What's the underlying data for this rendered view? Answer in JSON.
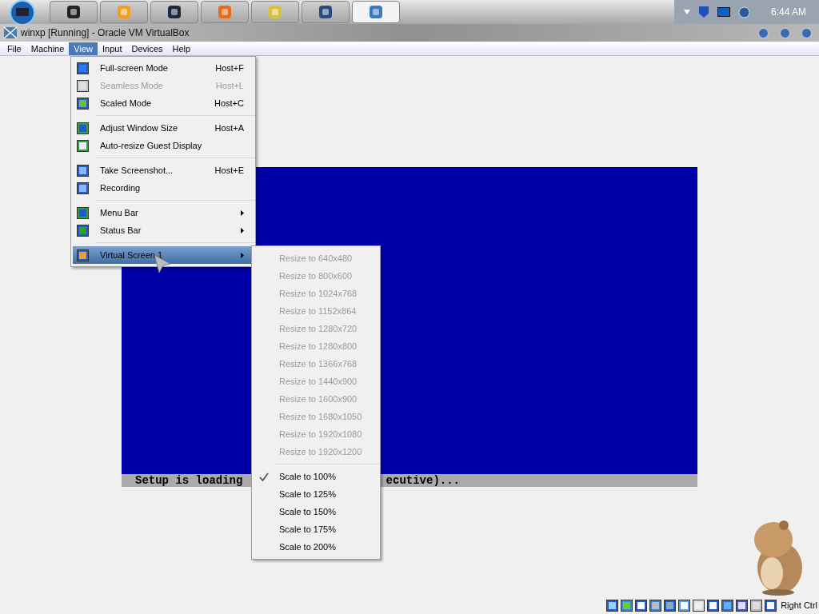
{
  "taskbar": {
    "apps": [
      {
        "selected": false
      },
      {
        "selected": false
      },
      {
        "selected": false
      },
      {
        "selected": false
      },
      {
        "selected": false
      },
      {
        "selected": false
      },
      {
        "selected": true
      }
    ],
    "clock": "6:44 AM"
  },
  "window": {
    "title": "winxp [Running] - Oracle VM VirtualBox"
  },
  "menu_bar": [
    {
      "label": "File",
      "selected": false
    },
    {
      "label": "Machine",
      "selected": false
    },
    {
      "label": "View",
      "selected": true
    },
    {
      "label": "Input",
      "selected": false
    },
    {
      "label": "Devices",
      "selected": false
    },
    {
      "label": "Help",
      "selected": false
    }
  ],
  "view_menu": {
    "sections": [
      [
        {
          "label": "Full-screen Mode",
          "shortcut": "Host+F",
          "disabled": false,
          "submenu": false,
          "selected": false
        },
        {
          "label": "Seamless Mode",
          "shortcut": "Host+L",
          "disabled": true,
          "submenu": false,
          "selected": false
        },
        {
          "label": "Scaled Mode",
          "shortcut": "Host+C",
          "disabled": false,
          "submenu": false,
          "selected": false
        }
      ],
      [
        {
          "label": "Adjust Window Size",
          "shortcut": "Host+A",
          "disabled": false,
          "submenu": false,
          "selected": false
        },
        {
          "label": "Auto-resize Guest Display",
          "disabled": false,
          "submenu": false,
          "selected": false
        }
      ],
      [
        {
          "label": "Take Screenshot...",
          "shortcut": "Host+E",
          "disabled": false,
          "submenu": false,
          "selected": false
        },
        {
          "label": "Recording",
          "disabled": false,
          "submenu": false,
          "selected": false
        }
      ],
      [
        {
          "label": "Menu Bar",
          "disabled": false,
          "submenu": true,
          "selected": false
        },
        {
          "label": "Status Bar",
          "disabled": false,
          "submenu": true,
          "selected": false
        }
      ],
      [
        {
          "label": "Virtual Screen 1",
          "disabled": false,
          "submenu": true,
          "selected": true
        }
      ]
    ]
  },
  "virtual_screen_menu": {
    "sections": [
      [
        {
          "label": "Resize to 640x480",
          "disabled": true,
          "checked": false
        },
        {
          "label": "Resize to 800x600",
          "disabled": true,
          "checked": false
        },
        {
          "label": "Resize to 1024x768",
          "disabled": true,
          "checked": false
        },
        {
          "label": "Resize to 1152x864",
          "disabled": true,
          "checked": false
        },
        {
          "label": "Resize to 1280x720",
          "disabled": true,
          "checked": false
        },
        {
          "label": "Resize to 1280x800",
          "disabled": true,
          "checked": false
        },
        {
          "label": "Resize to 1366x768",
          "disabled": true,
          "checked": false
        },
        {
          "label": "Resize to 1440x900",
          "disabled": true,
          "checked": false
        },
        {
          "label": "Resize to 1600x900",
          "disabled": true,
          "checked": false
        },
        {
          "label": "Resize to 1680x1050",
          "disabled": true,
          "checked": false
        },
        {
          "label": "Resize to 1920x1080",
          "disabled": true,
          "checked": false
        },
        {
          "label": "Resize to 1920x1200",
          "disabled": true,
          "checked": false
        }
      ],
      [
        {
          "label": "Scale to 100%",
          "disabled": false,
          "checked": true
        },
        {
          "label": "Scale to 125%",
          "disabled": false,
          "checked": false
        },
        {
          "label": "Scale to 150%",
          "disabled": false,
          "checked": false
        },
        {
          "label": "Scale to 175%",
          "disabled": false,
          "checked": false
        },
        {
          "label": "Scale to 200%",
          "disabled": false,
          "checked": false
        }
      ]
    ]
  },
  "guest_screen": {
    "status_text_left": "Setup is loading",
    "status_text_right": "ecutive)..."
  },
  "status_bar": {
    "host_key": "Right Ctrl"
  }
}
